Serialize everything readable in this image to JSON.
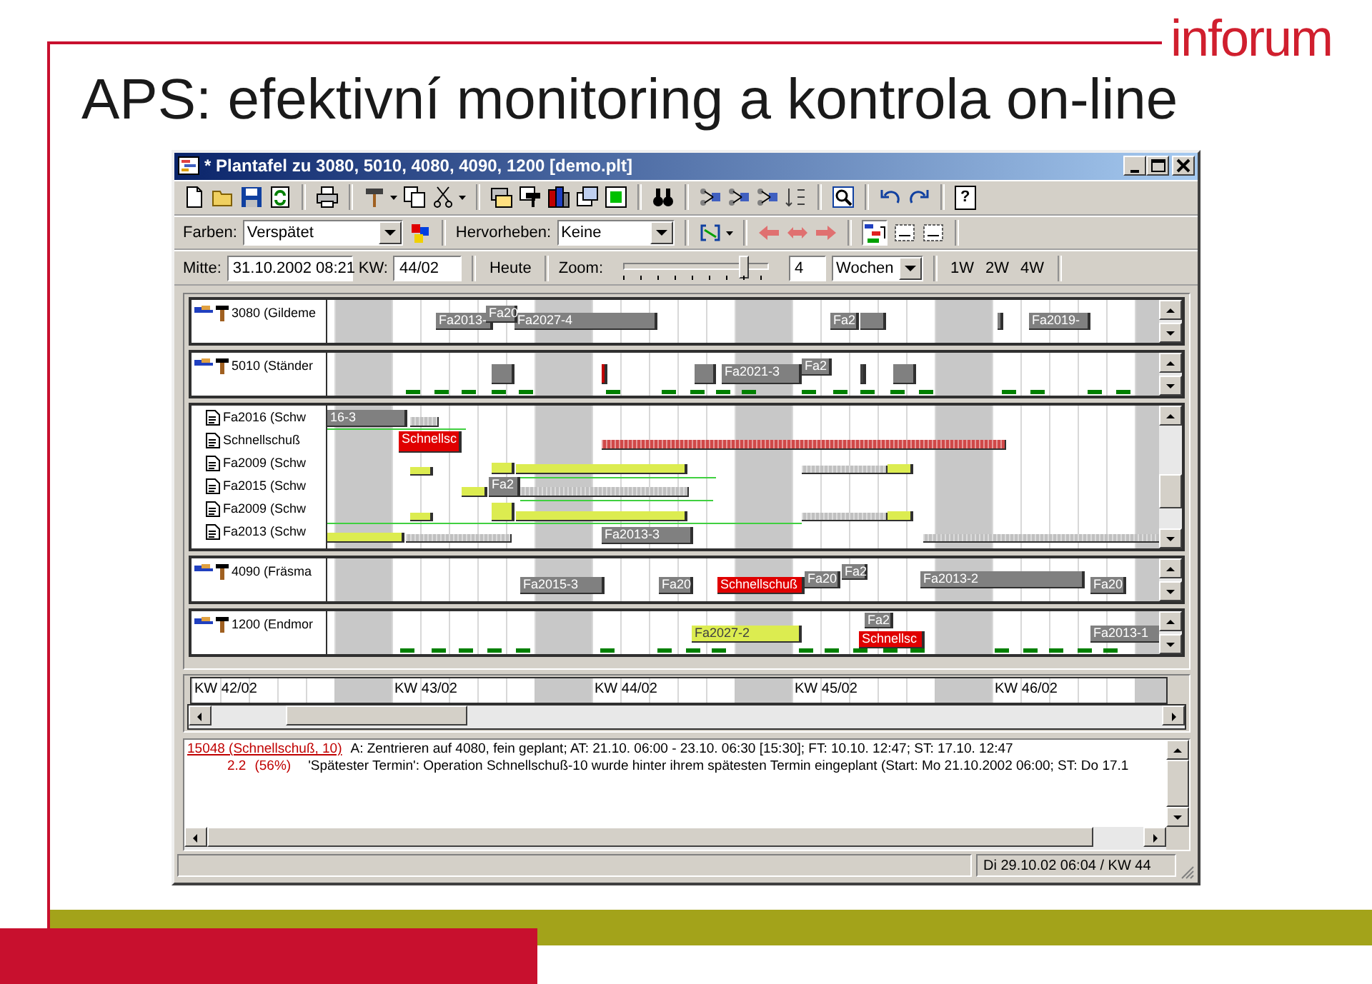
{
  "slide": {
    "title": "APS: efektivní monitoring a kontrola on-line",
    "logo": "inforum"
  },
  "window": {
    "title": "* Plantafel zu 3080, 5010, 4080, 4090, 1200  [demo.plt]"
  },
  "toolbar": {
    "help_button": "?"
  },
  "filter_bar": {
    "colors_label": "Farben:",
    "colors_value": "Verspätet",
    "highlight_label": "Hervorheben:",
    "highlight_value": "Keine"
  },
  "navigation_bar": {
    "center_label": "Mitte:",
    "center_value": "31.10.2002 08:21",
    "week_label": "KW:",
    "week_value": "44/02",
    "today_button": "Heute",
    "zoom_label": "Zoom:",
    "zoom": {
      "level": 0.83
    },
    "zoom_count": "4",
    "zoom_unit": "Wochen",
    "spans": [
      {
        "label": "1W"
      },
      {
        "label": "2W"
      },
      {
        "label": "4W"
      }
    ]
  },
  "gantt": {
    "panels": [
      {
        "kind": "machine",
        "label": "3080 (Gildeme",
        "bars": [
          {
            "kind": "solid",
            "label": "Fa2013-",
            "color": "#808080"
          },
          {
            "kind": "solid",
            "label": "Fa2027-4",
            "color": "#808080"
          },
          {
            "kind": "solid",
            "label": "Fa20",
            "color": "#808080"
          },
          {
            "kind": "solid",
            "label": "Fa2",
            "color": "#808080"
          },
          {
            "kind": "solid",
            "color": "#808080"
          },
          {
            "kind": "solid",
            "color": "#808080"
          },
          {
            "kind": "solid",
            "label": "Fa2019-",
            "color": "#808080"
          }
        ]
      },
      {
        "kind": "machine",
        "label": "5010 (Ständer",
        "bars": [
          {
            "kind": "solid",
            "color": "#808080"
          },
          {
            "kind": "solid",
            "color": "#c00000"
          },
          {
            "kind": "solid",
            "color": "#808080"
          },
          {
            "kind": "solid",
            "label": "Fa2021-3",
            "color": "#808080"
          },
          {
            "kind": "solid",
            "label": "Fa2",
            "color": "#808080"
          },
          {
            "kind": "solid",
            "color": "#404040"
          },
          {
            "kind": "solid",
            "color": "#808080"
          }
        ]
      },
      {
        "kind": "orders",
        "rows": [
          {
            "label": "Fa2016 (Schw",
            "bars": [
              {
                "kind": "solid",
                "label": "16-3",
                "color": "#808080"
              },
              {
                "kind": "hatched",
                "color": "#c0c0c0"
              }
            ]
          },
          {
            "label": "Schnellschuß",
            "bars": [
              {
                "kind": "solid",
                "label": "Schnellsc",
                "color": "#e00000"
              },
              {
                "kind": "hatched",
                "color": "#d04848"
              }
            ]
          },
          {
            "label": "Fa2009 (Schw",
            "bars": [
              {
                "kind": "solid",
                "color": "#dcec50"
              },
              {
                "kind": "solid",
                "color": "#dcec50"
              },
              {
                "kind": "solid",
                "color": "#dcec50"
              },
              {
                "kind": "hatched",
                "color": "#c0c0c0"
              },
              {
                "kind": "solid",
                "color": "#dcec50"
              }
            ]
          },
          {
            "label": "Fa2015 (Schw",
            "bars": [
              {
                "kind": "solid",
                "color": "#dcec50"
              },
              {
                "kind": "solid",
                "label": "Fa2",
                "color": "#808080"
              },
              {
                "kind": "hatched",
                "color": "#c0c0c0"
              }
            ]
          },
          {
            "label": "Fa2009 (Schw",
            "bars": [
              {
                "kind": "solid",
                "color": "#dcec50"
              },
              {
                "kind": "solid",
                "color": "#dcec50"
              },
              {
                "kind": "solid",
                "color": "#dcec50"
              },
              {
                "kind": "hatched",
                "color": "#c0c0c0"
              },
              {
                "kind": "solid",
                "color": "#dcec50"
              }
            ]
          },
          {
            "label": "Fa2013 (Schw",
            "bars": [
              {
                "kind": "solid",
                "color": "#dcec50"
              },
              {
                "kind": "hatched",
                "color": "#c0c0c0"
              },
              {
                "kind": "solid",
                "label": "Fa2013-3",
                "color": "#808080"
              },
              {
                "kind": "hatched",
                "color": "#c0c0c0"
              }
            ]
          }
        ]
      },
      {
        "kind": "machine",
        "label": "4090 (Fräsma",
        "bars": [
          {
            "kind": "solid",
            "label": "Fa2015-3",
            "color": "#808080"
          },
          {
            "kind": "solid",
            "label": "Fa20",
            "color": "#808080"
          },
          {
            "kind": "solid",
            "label": "Schnellschuß",
            "color": "#e00000"
          },
          {
            "kind": "solid",
            "label": "Fa20",
            "color": "#808080"
          },
          {
            "kind": "solid",
            "label": "Fa2",
            "color": "#808080"
          },
          {
            "kind": "solid",
            "label": "Fa2013-2",
            "color": "#808080"
          },
          {
            "kind": "solid",
            "label": "Fa20",
            "color": "#808080"
          }
        ]
      },
      {
        "kind": "machine",
        "label": "1200 (Endmor",
        "bars": [
          {
            "kind": "solid",
            "label": "Fa2",
            "color": "#808080"
          },
          {
            "kind": "solid",
            "label": "Fa2027-2",
            "color": "#dcec50"
          },
          {
            "kind": "solid",
            "label": "Schnellsc",
            "color": "#e00000"
          },
          {
            "kind": "solid",
            "label": "Fa2013-1",
            "color": "#808080"
          }
        ]
      }
    ],
    "weeks": [
      "KW 42/02",
      "KW 43/02",
      "KW 44/02",
      "KW 45/02",
      "KW 46/02"
    ]
  },
  "messages": [
    {
      "kind": "order",
      "link": "15048 (Schnellschuß, 10)",
      "text": "A: Zentrieren auf 4080, fein geplant;  AT: 21.10. 06:00 - 23.10. 06:30 [15:30];  FT: 10.10. 12:47;  ST: 17.10. 12:47"
    },
    {
      "kind": "warning",
      "code": "2.2",
      "percent": "(56%)",
      "text": "'Spätester Termin': Operation Schnellschuß-10 wurde hinter ihrem spätesten Termin eingeplant (Start: Mo 21.10.2002 06:00; ST: Do 17.1"
    }
  ],
  "status_bar": {
    "text": "Di 29.10.02 06:04 / KW 44"
  }
}
